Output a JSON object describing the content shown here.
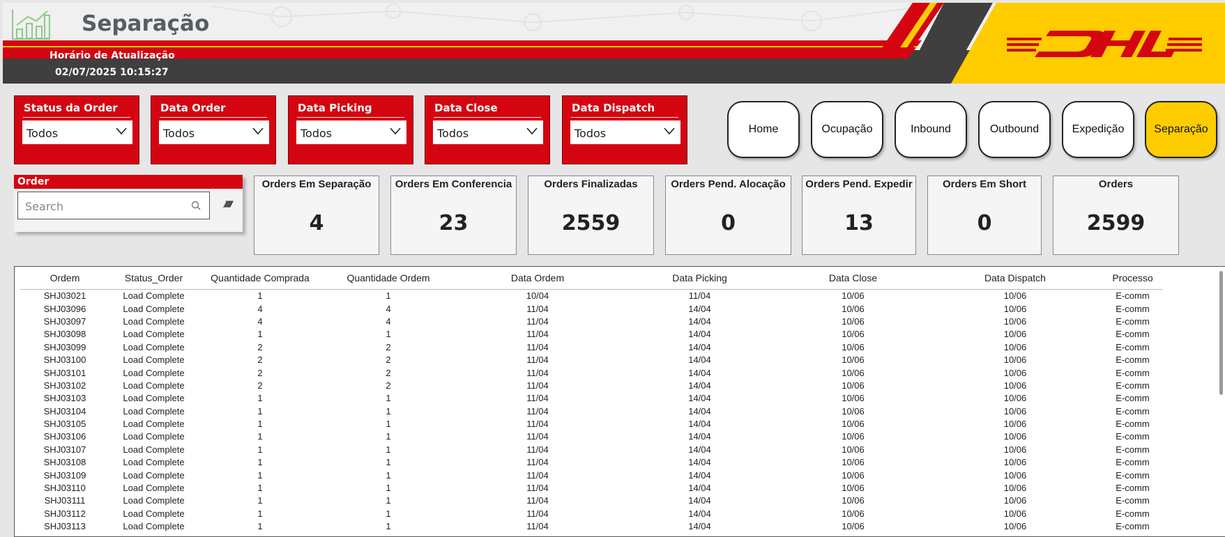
{
  "header": {
    "title": "Separação",
    "update_label": "Horário de Atualização",
    "update_value": "02/07/2025 10:15:27",
    "brand_logo_text": "DHL",
    "colors": {
      "red": "#d40511",
      "yellow": "#ffcc00",
      "dark": "#3f3f3f"
    }
  },
  "filters": [
    {
      "label": "Status da Order",
      "value": "Todos"
    },
    {
      "label": "Data Order",
      "value": "Todos"
    },
    {
      "label": "Data Picking",
      "value": "Todos"
    },
    {
      "label": "Data Close",
      "value": "Todos"
    },
    {
      "label": "Data Dispatch",
      "value": "Todos"
    }
  ],
  "nav": [
    {
      "label": "Home",
      "active": false
    },
    {
      "label": "Ocupação",
      "active": false
    },
    {
      "label": "Inbound",
      "active": false
    },
    {
      "label": "Outbound",
      "active": false
    },
    {
      "label": "Expedição",
      "active": false
    },
    {
      "label": "Separação",
      "active": true
    }
  ],
  "order_search": {
    "label": "Order",
    "placeholder": "Search"
  },
  "kpis": [
    {
      "title": "Orders Em Separação",
      "value": "4"
    },
    {
      "title": "Orders Em Conferencia",
      "value": "23"
    },
    {
      "title": "Orders Finalizadas",
      "value": "2559"
    },
    {
      "title": "Orders Pend. Alocação",
      "value": "0"
    },
    {
      "title": "Orders Pend. Expedir",
      "value": "13"
    },
    {
      "title": "Orders Em Short",
      "value": "0"
    },
    {
      "title": "Orders",
      "value": "2599"
    }
  ],
  "table": {
    "columns": [
      "Ordem",
      "Status_Order",
      "Quantidade Comprada",
      "Quantidade Ordem",
      "Data Ordem",
      "Data Picking",
      "Data Close",
      "Data Dispatch",
      "Processo"
    ],
    "rows": [
      [
        "SHJ03021",
        "Load Complete",
        "1",
        "1",
        "10/04",
        "11/04",
        "10/06",
        "10/06",
        "E-comm"
      ],
      [
        "SHJ03096",
        "Load Complete",
        "4",
        "4",
        "11/04",
        "14/04",
        "10/06",
        "10/06",
        "E-comm"
      ],
      [
        "SHJ03097",
        "Load Complete",
        "4",
        "4",
        "11/04",
        "14/04",
        "10/06",
        "10/06",
        "E-comm"
      ],
      [
        "SHJ03098",
        "Load Complete",
        "1",
        "1",
        "11/04",
        "14/04",
        "10/06",
        "10/06",
        "E-comm"
      ],
      [
        "SHJ03099",
        "Load Complete",
        "2",
        "2",
        "11/04",
        "14/04",
        "10/06",
        "10/06",
        "E-comm"
      ],
      [
        "SHJ03100",
        "Load Complete",
        "2",
        "2",
        "11/04",
        "14/04",
        "10/06",
        "10/06",
        "E-comm"
      ],
      [
        "SHJ03101",
        "Load Complete",
        "2",
        "2",
        "11/04",
        "14/04",
        "10/06",
        "10/06",
        "E-comm"
      ],
      [
        "SHJ03102",
        "Load Complete",
        "2",
        "2",
        "11/04",
        "14/04",
        "10/06",
        "10/06",
        "E-comm"
      ],
      [
        "SHJ03103",
        "Load Complete",
        "1",
        "1",
        "11/04",
        "14/04",
        "10/06",
        "10/06",
        "E-comm"
      ],
      [
        "SHJ03104",
        "Load Complete",
        "1",
        "1",
        "11/04",
        "14/04",
        "10/06",
        "10/06",
        "E-comm"
      ],
      [
        "SHJ03105",
        "Load Complete",
        "1",
        "1",
        "11/04",
        "14/04",
        "10/06",
        "10/06",
        "E-comm"
      ],
      [
        "SHJ03106",
        "Load Complete",
        "1",
        "1",
        "11/04",
        "14/04",
        "10/06",
        "10/06",
        "E-comm"
      ],
      [
        "SHJ03107",
        "Load Complete",
        "1",
        "1",
        "11/04",
        "14/04",
        "10/06",
        "10/06",
        "E-comm"
      ],
      [
        "SHJ03108",
        "Load Complete",
        "1",
        "1",
        "11/04",
        "14/04",
        "10/06",
        "10/06",
        "E-comm"
      ],
      [
        "SHJ03109",
        "Load Complete",
        "1",
        "1",
        "11/04",
        "14/04",
        "10/06",
        "10/06",
        "E-comm"
      ],
      [
        "SHJ03110",
        "Load Complete",
        "1",
        "1",
        "11/04",
        "14/04",
        "10/06",
        "10/06",
        "E-comm"
      ],
      [
        "SHJ03111",
        "Load Complete",
        "1",
        "1",
        "11/04",
        "14/04",
        "10/06",
        "10/06",
        "E-comm"
      ],
      [
        "SHJ03112",
        "Load Complete",
        "1",
        "1",
        "11/04",
        "14/04",
        "10/06",
        "10/06",
        "E-comm"
      ],
      [
        "SHJ03113",
        "Load Complete",
        "1",
        "1",
        "11/04",
        "14/04",
        "10/06",
        "10/06",
        "E-comm"
      ]
    ]
  },
  "icons": {
    "title_logo": "bar-chart-icon",
    "dropdown": "chevron-down-icon",
    "search": "search-icon",
    "clear": "eraser-icon"
  }
}
